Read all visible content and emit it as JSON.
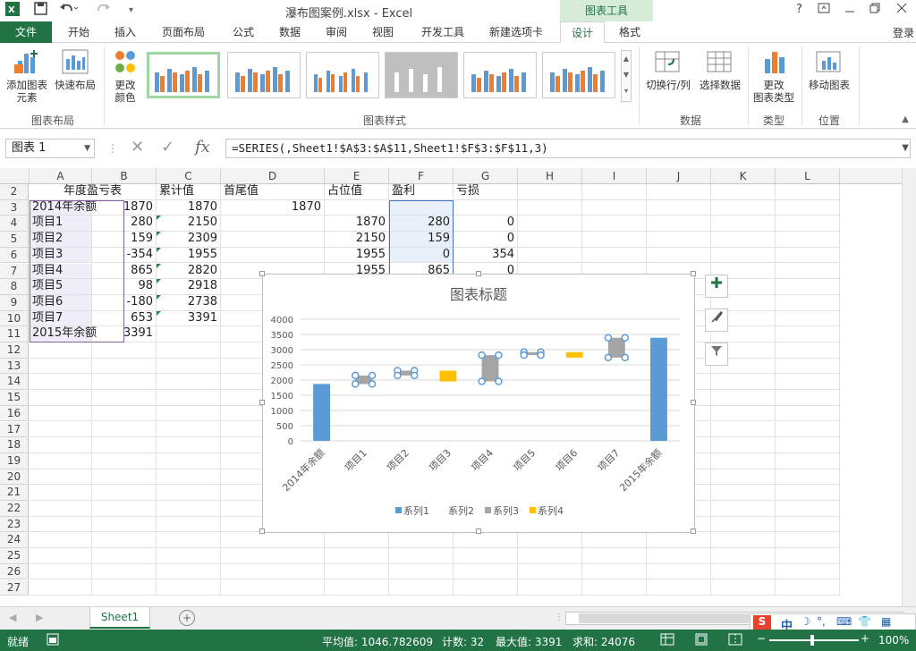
{
  "titlebar": {
    "title": "瀑布图案例.xlsx - Excel",
    "context_tab_label": "图表工具",
    "help_label": "?",
    "login_label": "登录"
  },
  "ribbon_tabs": [
    "文件",
    "开始",
    "插入",
    "页面布局",
    "公式",
    "数据",
    "审阅",
    "视图",
    "开发工具",
    "新建选项卡",
    "设计",
    "格式"
  ],
  "ribbon": {
    "add_element_label_1": "添加图表",
    "add_element_label_2": "元素",
    "quick_layout_label": "快速布局",
    "change_colors_label_1": "更改",
    "change_colors_label_2": "颜色",
    "switch_row_col_label": "切换行/列",
    "select_data_label": "选择数据",
    "change_type_label_1": "更改",
    "change_type_label_2": "图表类型",
    "move_chart_label": "移动图表",
    "group_layout": "图表布局",
    "group_styles": "图表样式",
    "group_data": "数据",
    "group_type": "类型",
    "group_location": "位置"
  },
  "formula_bar": {
    "name_box": "图表 1",
    "fx_label": "fx",
    "formula": "=SERIES(,Sheet1!$A$3:$A$11,Sheet1!$F$3:$F$11,3)"
  },
  "columns": [
    "A",
    "B",
    "C",
    "D",
    "E",
    "F",
    "G",
    "H",
    "I",
    "J",
    "K",
    "L"
  ],
  "rows": [
    "2",
    "3",
    "4",
    "5",
    "6",
    "7",
    "8",
    "9",
    "10",
    "11",
    "12",
    "13",
    "14",
    "15",
    "16",
    "17",
    "18",
    "19",
    "20",
    "21",
    "22",
    "23",
    "24",
    "25",
    "26",
    "27"
  ],
  "table": {
    "headers": {
      "a": "年度盈亏表",
      "c": "累计值",
      "d": "首尾值",
      "e": "占位值",
      "f": "盈利",
      "g": "亏损"
    },
    "rows": [
      {
        "a": "2014年余额",
        "b": "1870",
        "c": "1870",
        "d": "1870",
        "e": "",
        "f": "",
        "g": ""
      },
      {
        "a": "项目1",
        "b": "280",
        "c": "2150",
        "d": "",
        "e": "1870",
        "f": "280",
        "g": "0"
      },
      {
        "a": "项目2",
        "b": "159",
        "c": "2309",
        "d": "",
        "e": "2150",
        "f": "159",
        "g": "0"
      },
      {
        "a": "项目3",
        "b": "-354",
        "c": "1955",
        "d": "",
        "e": "1955",
        "f": "0",
        "g": "354"
      },
      {
        "a": "项目4",
        "b": "865",
        "c": "2820",
        "d": "",
        "e": "1955",
        "f": "865",
        "g": "0"
      },
      {
        "a": "项目5",
        "b": "98",
        "c": "2918",
        "d": "",
        "e": "",
        "f": "",
        "g": ""
      },
      {
        "a": "项目6",
        "b": "-180",
        "c": "2738",
        "d": "",
        "e": "",
        "f": "",
        "g": ""
      },
      {
        "a": "项目7",
        "b": "653",
        "c": "3391",
        "d": "",
        "e": "",
        "f": "",
        "g": ""
      },
      {
        "a": "2015年余额",
        "b": "3391",
        "c": "",
        "d": "",
        "e": "",
        "f": "",
        "g": ""
      }
    ]
  },
  "chart_data": {
    "type": "bar",
    "title": "图表标题",
    "categories": [
      "2014年余额",
      "项目1",
      "项目2",
      "项目3",
      "项目4",
      "项目5",
      "项目6",
      "项目7",
      "2015年余额"
    ],
    "ylim": [
      0,
      4000
    ],
    "yticks": [
      "0",
      "500",
      "1000",
      "1500",
      "2000",
      "2500",
      "3000",
      "3500",
      "4000"
    ],
    "stacked": true,
    "series": [
      {
        "name": "系列1",
        "color": "#5b9bd5",
        "values": [
          1870,
          0,
          0,
          0,
          0,
          0,
          0,
          0,
          3391
        ]
      },
      {
        "name": "系列2",
        "color": "none",
        "values": [
          0,
          1870,
          2150,
          1955,
          1955,
          2820,
          2738,
          2738,
          0
        ]
      },
      {
        "name": "系列3",
        "color": "#a5a5a5",
        "values": [
          0,
          280,
          159,
          0,
          865,
          98,
          0,
          653,
          0
        ]
      },
      {
        "name": "系列4",
        "color": "#ffc000",
        "values": [
          0,
          0,
          0,
          354,
          0,
          0,
          180,
          0,
          0
        ]
      }
    ],
    "selected_series": "系列3",
    "legend_position": "bottom",
    "grid": true
  },
  "sheet_tab": "Sheet1",
  "status": {
    "ready": "就绪",
    "average": "平均值: 1046.782609",
    "count": "计数: 32",
    "max": "最大值: 3391",
    "sum": "求和: 24076",
    "zoom": "100%"
  },
  "ime": {
    "label": "中"
  }
}
